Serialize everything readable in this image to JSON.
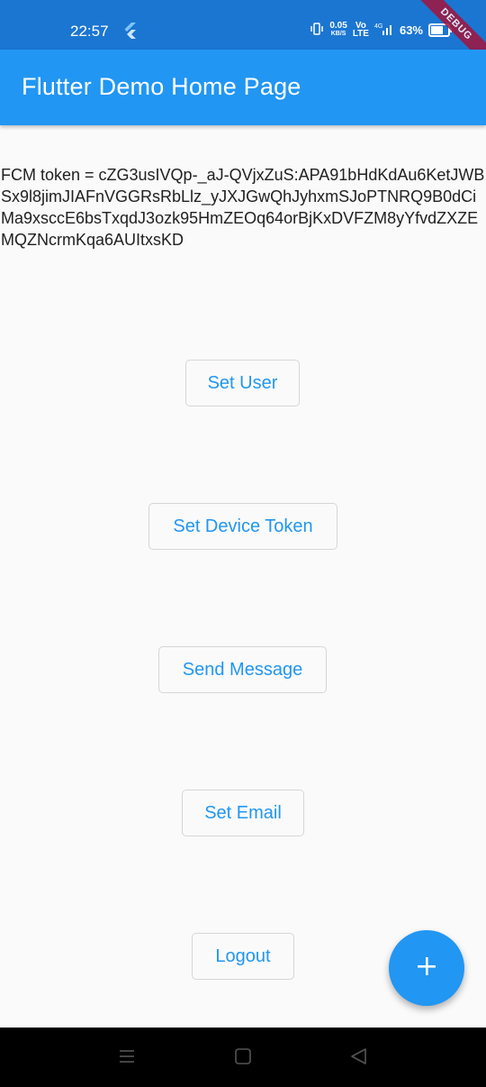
{
  "status_bar": {
    "time": "22:57",
    "net_speed_value": "0.05",
    "net_speed_unit": "KB/S",
    "volte_label": "Vo\nLTE",
    "network_label": "4G",
    "battery_percent": "63%",
    "battery_level": 0.63
  },
  "debug_banner": "DEBUG",
  "app_bar": {
    "title": "Flutter Demo Home Page"
  },
  "main": {
    "token_text": "FCM token = cZG3usIVQp-_aJ-QVjxZuS:APA91bHdKdAu6KetJWBSx9l8jimJIAFnVGGRsRbLlz_yJXJGwQhJyhxmSJoPTNRQ9B0dCiMa9xsccE6bsTxqdJ3ozk95HmZEOq64orBjKxDVFZM8yYfvdZXZEMQZNcrmKqa6AUItxsKD",
    "buttons": {
      "set_user": "Set User",
      "set_device_token": "Set Device Token",
      "send_message": "Send Message",
      "set_email": "Set Email",
      "logout": "Logout"
    }
  },
  "fab": {
    "icon": "plus-icon"
  },
  "nav_bar": {
    "icons": [
      "menu-icon",
      "home-icon",
      "back-icon"
    ]
  },
  "colors": {
    "primary": "#2196f3",
    "status_bar": "#1b76d2",
    "background": "#fafafa"
  }
}
